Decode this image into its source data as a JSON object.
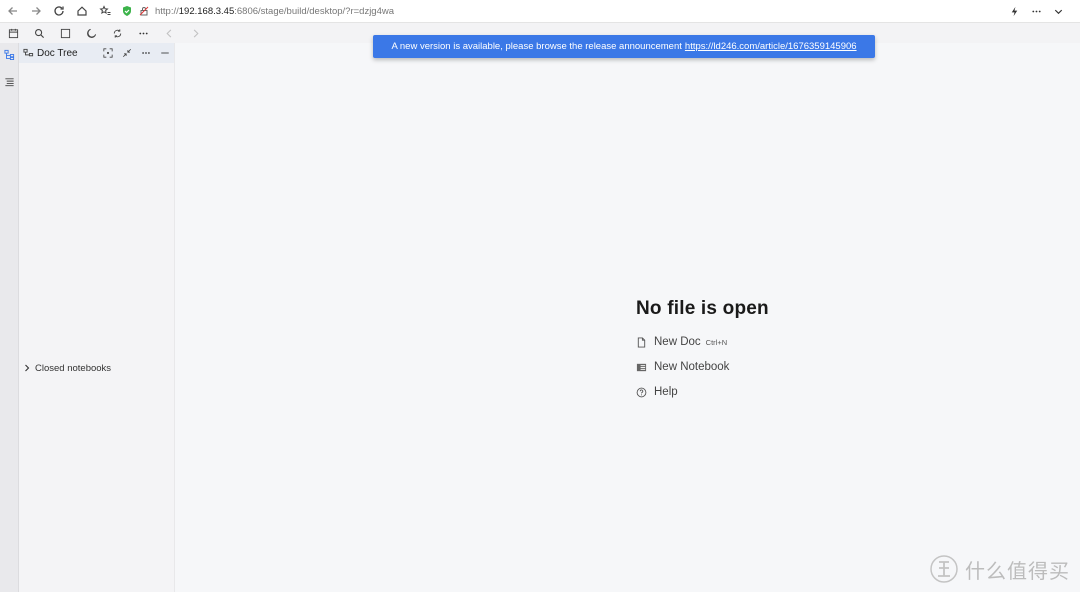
{
  "browser": {
    "url_prefix": "http://",
    "url_host": "192.168.3.45",
    "url_rest": ":6806/stage/build/desktop/?r=dzjg4wa"
  },
  "notice": {
    "text": "A new version is available, please browse the release announcement",
    "link": "https://ld246.com/article/1676359145906",
    "color": "#3b78e7"
  },
  "doc_tree": {
    "title": "Doc Tree",
    "closed_notebooks": "Closed notebooks"
  },
  "empty_state": {
    "title": "No file is open",
    "new_doc": "New Doc",
    "new_doc_shortcut": "Ctrl+N",
    "new_notebook": "New Notebook",
    "help": "Help"
  },
  "watermark": {
    "text": "什么值得买"
  }
}
